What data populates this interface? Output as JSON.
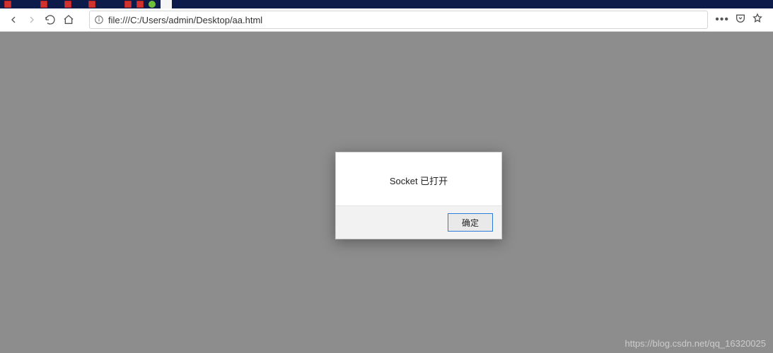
{
  "toolbar": {
    "url": "file:///C:/Users/admin/Desktop/aa.html"
  },
  "dialog": {
    "message": "Socket 已打开",
    "confirm_label": "确定"
  },
  "watermark": "https://blog.csdn.net/qq_16320025"
}
